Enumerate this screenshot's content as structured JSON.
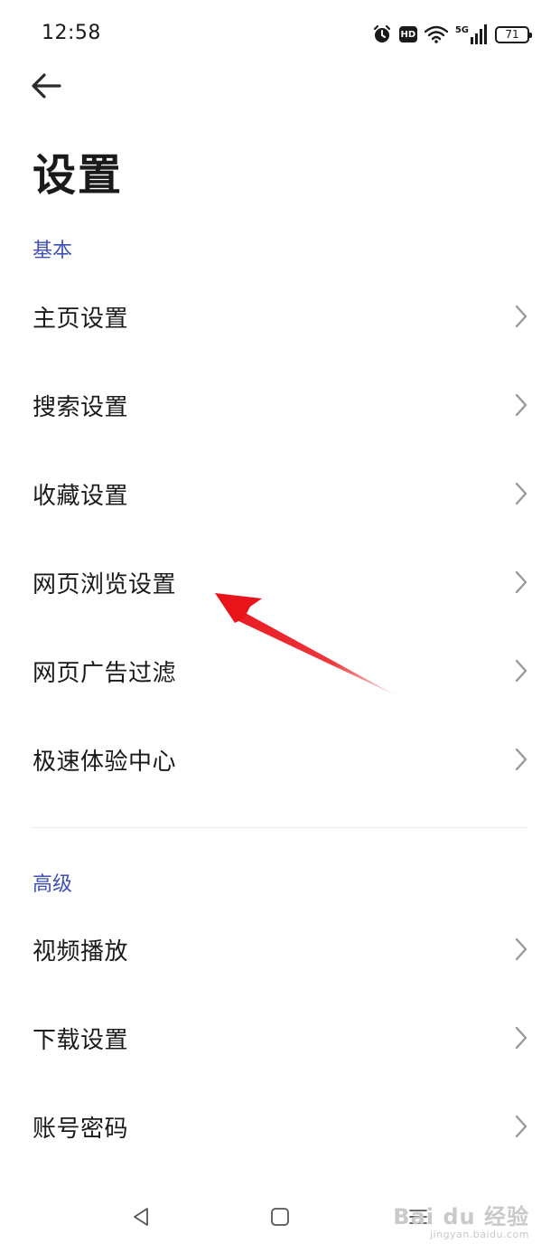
{
  "status_bar": {
    "time": "12:58",
    "hd_label": "HD",
    "network_label": "5G",
    "battery_level": "71",
    "icons": [
      "alarm-icon",
      "hd-icon",
      "wifi-icon",
      "signal-5g-icon",
      "battery-icon"
    ]
  },
  "header": {
    "back_icon": "back-arrow-icon",
    "title": "设置"
  },
  "sections": [
    {
      "title": "基本",
      "items": [
        {
          "label": "主页设置"
        },
        {
          "label": "搜索设置"
        },
        {
          "label": "收藏设置"
        },
        {
          "label": "网页浏览设置"
        },
        {
          "label": "网页广告过滤"
        },
        {
          "label": "极速体验中心"
        }
      ]
    },
    {
      "title": "高级",
      "items": [
        {
          "label": "视频播放"
        },
        {
          "label": "下载设置"
        },
        {
          "label": "账号密码"
        }
      ]
    }
  ],
  "annotation": {
    "color": "#e8141a",
    "points_to": "网页浏览设置"
  },
  "nav_bar": {
    "icons": [
      "nav-back-icon",
      "nav-home-icon",
      "nav-recents-icon"
    ]
  },
  "watermark": {
    "main": "Bai du 经验",
    "sub": "jingyan.baidu.com"
  },
  "colors": {
    "accent": "#3f51b5",
    "text": "#1a1a1a",
    "chevron": "#9a9a9a"
  }
}
